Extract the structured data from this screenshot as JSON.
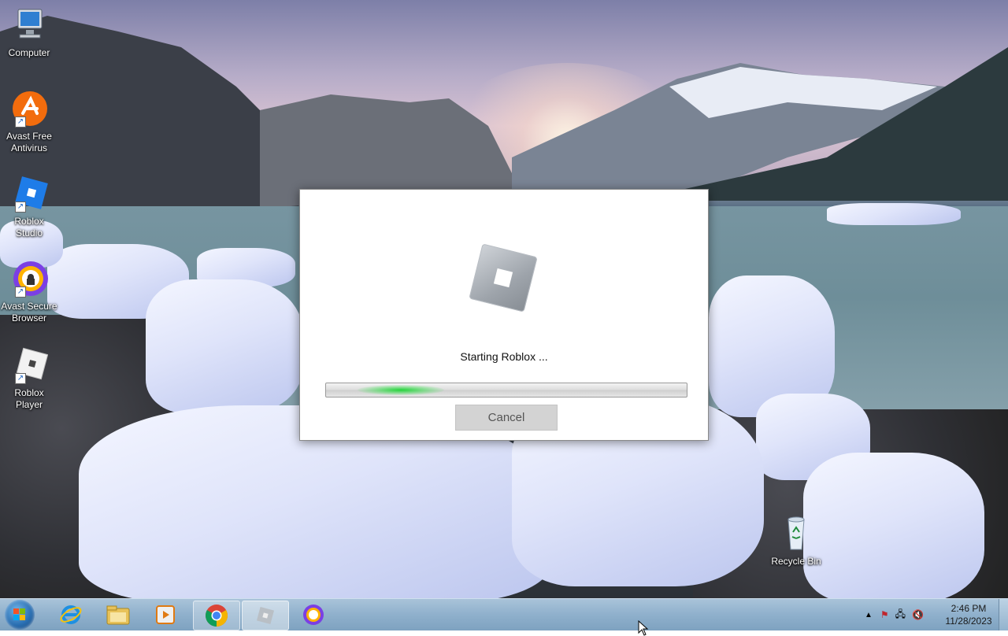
{
  "desktop": {
    "icons": [
      {
        "label_line1": "Computer",
        "label_line2": ""
      },
      {
        "label_line1": "Avast Free",
        "label_line2": "Antivirus"
      },
      {
        "label_line1": "Roblox",
        "label_line2": "Studio"
      },
      {
        "label_line1": "Avast Secure",
        "label_line2": "Browser"
      },
      {
        "label_line1": "Roblox Player",
        "label_line2": ""
      },
      {
        "label_line1": "Recycle Bin",
        "label_line2": ""
      }
    ]
  },
  "dialog": {
    "status_text": "Starting Roblox ...",
    "cancel_label": "Cancel",
    "progress_state": "indeterminate"
  },
  "taskbar": {
    "pinned": [
      "start-orb",
      "internet-explorer-icon",
      "file-explorer-icon",
      "media-player-icon",
      "chrome-icon",
      "roblox-icon",
      "avast-browser-icon"
    ],
    "active_item": "roblox-icon",
    "clock_time": "2:46 PM",
    "clock_date": "11/28/2023"
  },
  "colors": {
    "taskbar": "#8fb0cc",
    "progress_glow": "#25d43b",
    "avast_orange": "#f26c0d"
  }
}
